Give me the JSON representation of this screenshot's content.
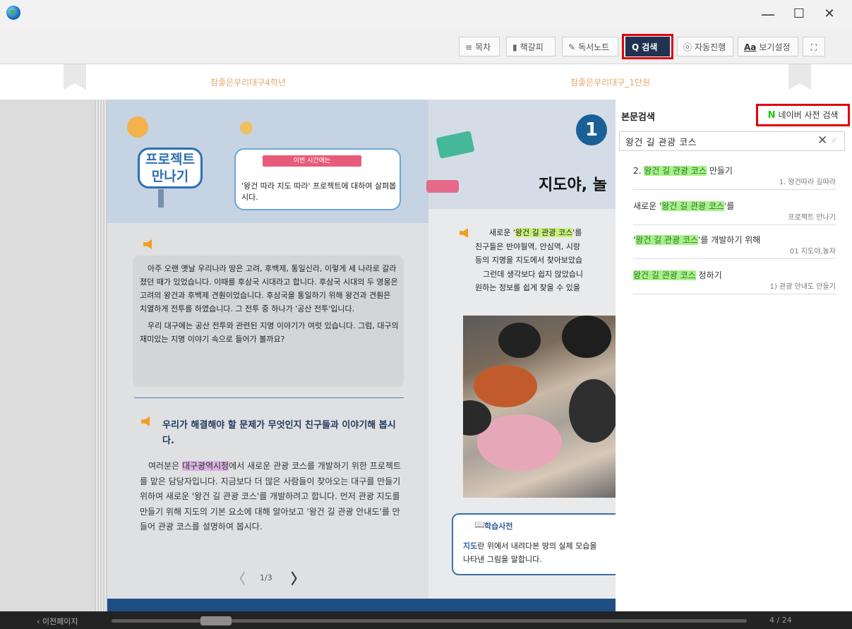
{
  "window": {
    "minimize": "—",
    "maximize": "☐",
    "close": "✕"
  },
  "toolbar": {
    "toc": "목차",
    "bookmark": "책갈피",
    "note": "독서노트",
    "search": "검색",
    "auto": "자동진행",
    "view_prefix": "Aa",
    "view": "보기설정",
    "toc_icon": "≡",
    "bookmark_icon": "▮",
    "note_icon": "✎",
    "search_icon": "Q",
    "auto_icon": "ⓞ",
    "expand_icon": "⛶"
  },
  "header": {
    "left_title": "참좋은우리대구4학년",
    "right_title": "참좋은우리대구_1단원"
  },
  "left_page": {
    "project_line1": "프로젝트",
    "project_line2": "만나기",
    "bubble_tag": "이번 시간에는",
    "bubble_text": "'왕건 따라 지도 따라' 프로젝트에 대하여 살펴봅시다.",
    "story_p1": "아주 오랜 옛날 우리나라 땅은 고려, 후백제, 통일신라, 이렇게 세 나라로 갈라졌던 때가 있었습니다. 이때를 후삼국 시대라고 합니다. 후삼국 시대의 두 영웅은 고려의 왕건과 후백제 견훤이었습니다. 후삼국을 통일하기 위해 왕건과 견훤은 치열하게 전투를 하였습니다. 그 전투 중 하나가 '공산 전투'입니다.",
    "story_p2": "우리 대구에는 공산 전투와 관련된 지명 이야기가 여럿 있습니다. 그럼, 대구의 재미있는 지명 이야기 속으로 들어가 볼까요?",
    "heading": "우리가 해결해야 할 문제가 무엇인지 친구들과 이야기해 봅시다.",
    "body_pre": "여러분은 ",
    "body_hl": "대구광역시청",
    "body_post": "에서 새로운 관광 코스를 개발하기 위한 프로젝트를 맡은 담당자입니다. 지금보다 더 많은 사람들이 찾아오는 대구를 만들기 위하여 새로운 '왕건 길 관광 코스'를 개발하려고 합니다. 먼저 관광 지도를 만들기 위해 지도의 기본 요소에 대해 알아보고 '왕건 길 관광 안내도'를 만들어 관광 코스를 설명하여 봅시다.",
    "pager": "1/3",
    "prev_arrow": "〈",
    "next_arrow": "〉"
  },
  "right_page": {
    "chapter_num": "1",
    "chapter_title": "지도야, 놀",
    "line1_pre": "새로운 '",
    "line1_hl": "왕건 길 관광 코스",
    "line1_post": "'를",
    "line2": "친구들은 반야월역, 안심역, 시랑",
    "line3": "등의 지명을 지도에서 찾아보았습",
    "line4": "그런데 생각보다 쉽지 않았습니",
    "line5": "원하는 정보를 쉽게 찾을 수 있을",
    "dict_title": "학습사전",
    "dict_word": "지도",
    "dict_line1": "란 위에서 내려다본 땅의 실제 모습을",
    "dict_line2": "나타낸 그림을 말합니다."
  },
  "search_panel": {
    "title": "본문검색",
    "naver_n": "N",
    "naver_label": "네이버 사전 검색",
    "query": "왕건 길 관광 코스",
    "clear_icon": "✕",
    "search_icon": "⌕",
    "results": [
      {
        "pre": "2. ",
        "hl": "왕건 길 관광 코스",
        "post": " 만들기",
        "sub": "1. 왕건따라 길따라"
      },
      {
        "pre": "새로운 '",
        "hl": "왕건 길 관광 코스",
        "post": "'를",
        "sub": "프로젝트 만나기"
      },
      {
        "pre": "'",
        "hl": "왕건 길 관광 코스",
        "post": "'를 개발하기 위해",
        "sub": "01 지도야,놀자"
      },
      {
        "pre": "",
        "hl": "왕건 길 관광 코스",
        "post": " 정하기",
        "sub": "1) 관광 안내도 만들기"
      }
    ]
  },
  "status": {
    "prev": "‹ 이전페이지",
    "page_count": "4 / 24",
    "progress": 0.16
  }
}
